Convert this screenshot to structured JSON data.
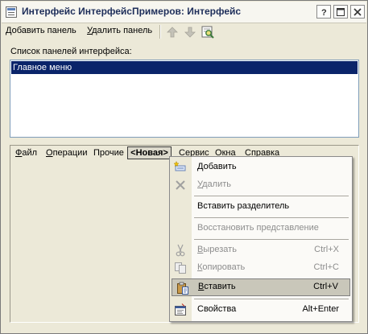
{
  "window": {
    "title": "Интерфейс ИнтерфейсПримеров: Интерфейс",
    "title_color": "#1e2e5a"
  },
  "title_buttons": [
    {
      "icon": "help-icon"
    },
    {
      "icon": "maximize-icon"
    },
    {
      "icon": "close-icon"
    }
  ],
  "toolbar": {
    "add_panel": {
      "hotkey": "Д",
      "rest": "обавить панель"
    },
    "delete_panel": {
      "hotkey": "У",
      "rest": "далить панель"
    },
    "icons": [
      "arrow-up-icon",
      "arrow-down-icon",
      "find-icon"
    ]
  },
  "panel_list": {
    "label": "Список панелей интерфейса:",
    "items": [
      "Главное меню"
    ],
    "selected_color": "#0a246a"
  },
  "menu_panel": {
    "items": [
      {
        "hotkey": "Ф",
        "rest": "айл"
      },
      {
        "hotkey": "О",
        "rest": "перации"
      },
      {
        "hotkey": "",
        "rest": "Прочие"
      },
      {
        "hotkey": "",
        "rest": "<Новая>",
        "active": true
      },
      {
        "hotkey": "С",
        "rest": "ервис"
      },
      {
        "hotkey": "О",
        "rest": "кна"
      },
      {
        "hotkey": "С",
        "rest": "правка"
      }
    ]
  },
  "context_menu": {
    "items": [
      {
        "icon": "add-icon",
        "hotkey": "Д",
        "rest": "обавить",
        "shortcut": "",
        "disabled": false
      },
      {
        "icon": "delete-icon",
        "hotkey": "У",
        "rest": "далить",
        "shortcut": "",
        "disabled": true
      },
      {
        "icon": "",
        "hotkey": "",
        "rest": "Вставить разделитель",
        "shortcut": "",
        "disabled": false
      },
      {
        "icon": "",
        "hotkey": "",
        "rest": "Восстановить представление",
        "shortcut": "",
        "disabled": true
      },
      {
        "icon": "cut-icon",
        "hotkey": "В",
        "rest": "ырезать",
        "shortcut": "Ctrl+X",
        "disabled": true
      },
      {
        "icon": "copy-icon",
        "hotkey": "К",
        "rest": "опировать",
        "shortcut": "Ctrl+C",
        "disabled": true
      },
      {
        "icon": "paste-icon",
        "hotkey": "В",
        "rest": "ставить",
        "shortcut": "Ctrl+V",
        "disabled": false,
        "highlighted": true
      },
      {
        "icon": "properties-icon",
        "hotkey": "",
        "rest": "Свойства",
        "shortcut": "Alt+Enter",
        "disabled": false
      }
    ]
  }
}
